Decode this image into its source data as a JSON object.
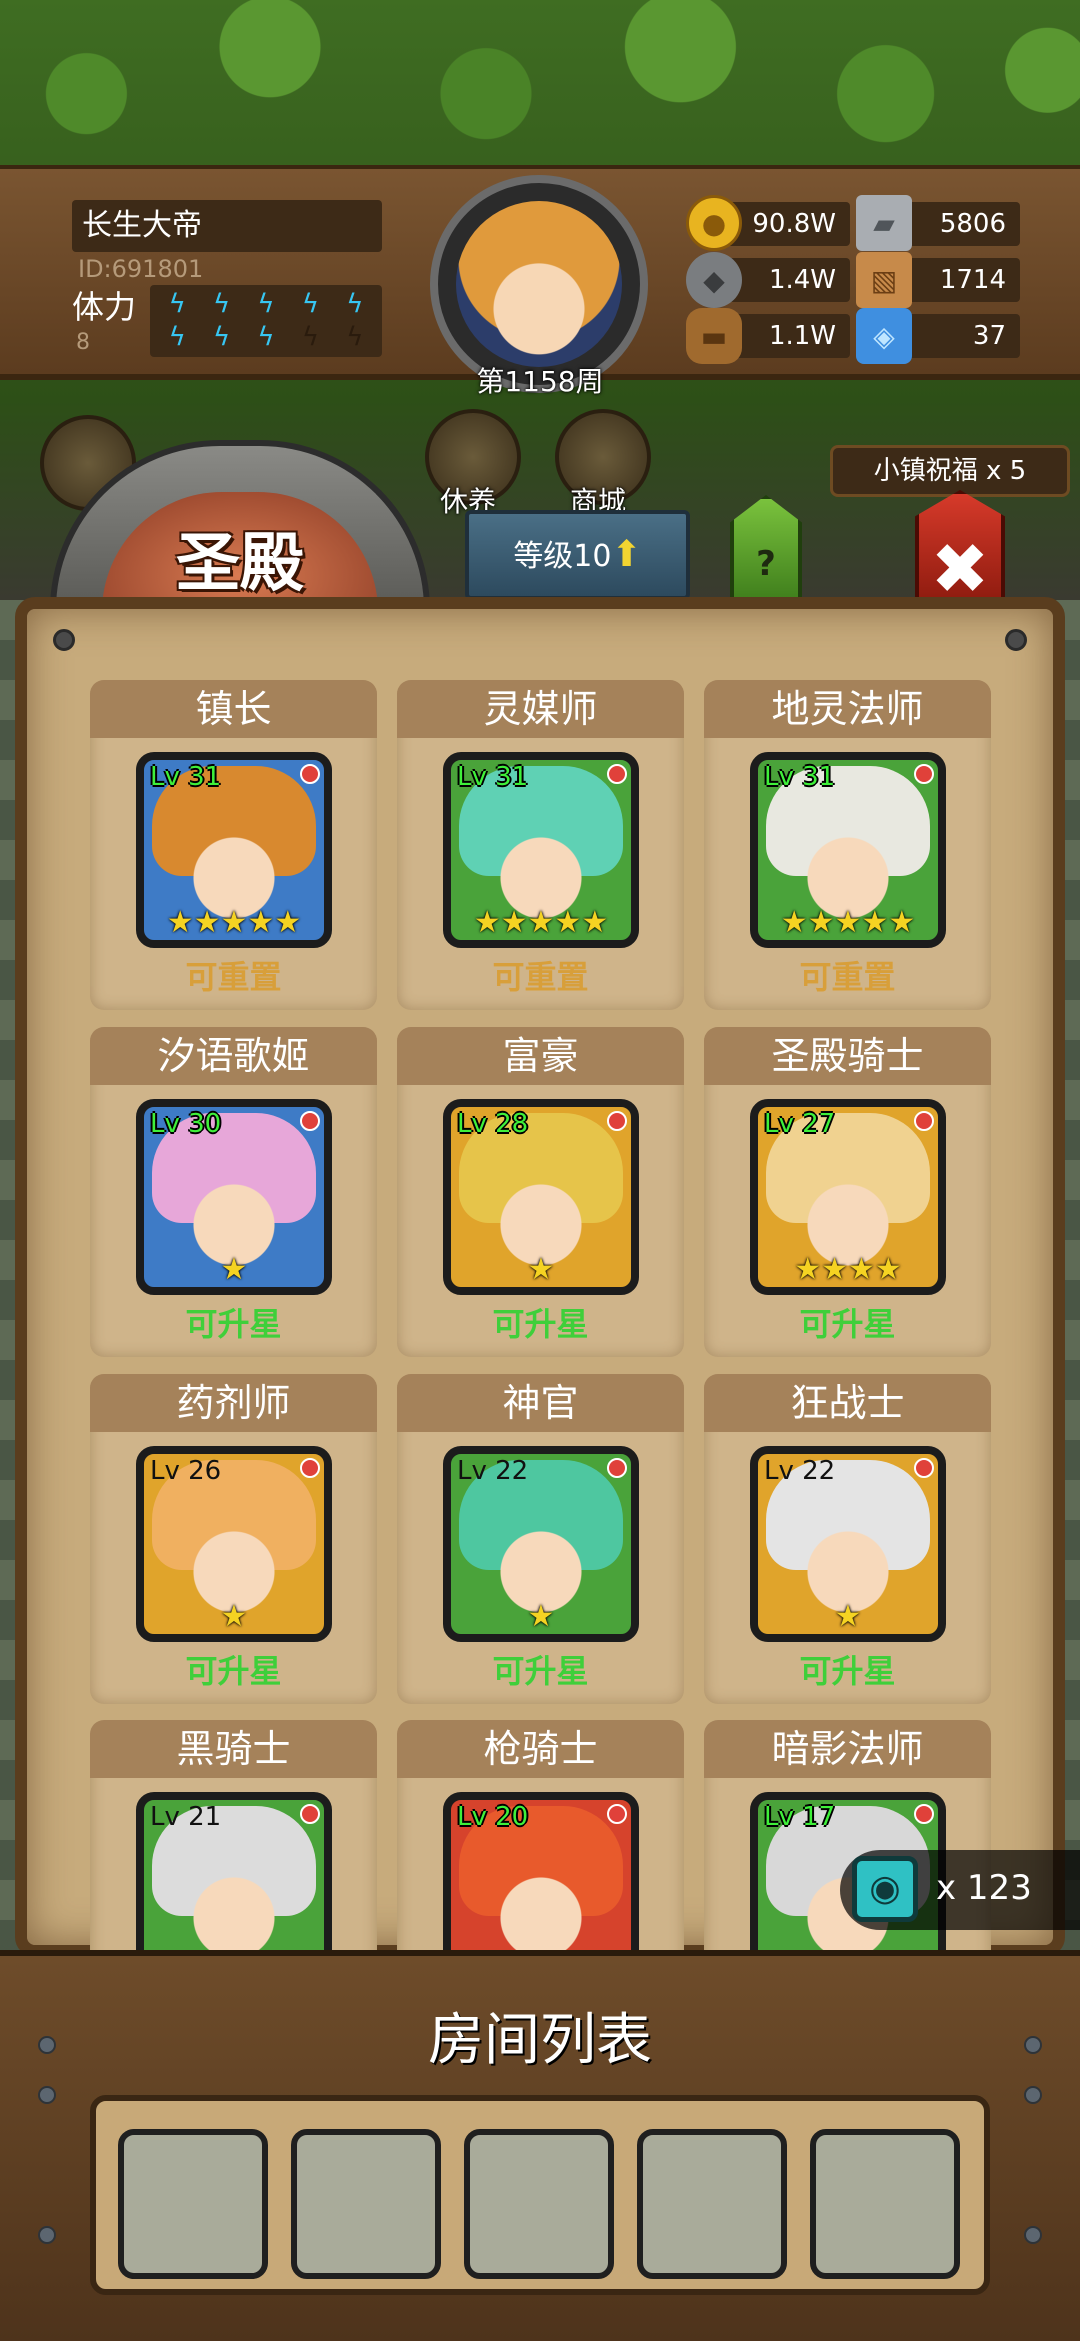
{
  "header": {
    "player_name": "长生大帝",
    "player_id": "ID:691801",
    "stamina_label": "体力",
    "stamina_value": "8",
    "stamina_full_count": 8,
    "week_label": "第1158周",
    "icons": {
      "gold": "gold-coin-icon",
      "iron": "iron-ingot-icon",
      "stone": "stone-icon",
      "leather": "leather-icon",
      "wood": "wood-icon",
      "crystal": "crystal-icon"
    }
  },
  "resources": {
    "gold": "90.8W",
    "iron": "5806",
    "stone": "1.4W",
    "leather": "1714",
    "wood": "1.1W",
    "crystal": "37"
  },
  "menu": {
    "rest_label": "休养",
    "mall_label": "商城",
    "blessing": "小镇祝福 x 5"
  },
  "title": {
    "hall": "圣殿",
    "level": "等级10",
    "help": "?",
    "close": "✖"
  },
  "heroes": [
    {
      "name": "镇长",
      "level": "Lv 31",
      "stars": "★★★★★",
      "status": "可重置",
      "frame": "blue",
      "hair": "#d8892f"
    },
    {
      "name": "灵媒师",
      "level": "Lv 31",
      "stars": "★★★★★",
      "status": "可重置",
      "frame": "green",
      "hair": "#5fd1b4"
    },
    {
      "name": "地灵法师",
      "level": "Lv 31",
      "stars": "★★★★★",
      "status": "可重置",
      "frame": "green",
      "hair": "#e8e8e0"
    },
    {
      "name": "汐语歌姬",
      "level": "Lv 30",
      "stars": "★",
      "status": "可升星",
      "frame": "blue",
      "hair": "#e7a7d9"
    },
    {
      "name": "富豪",
      "level": "Lv 28",
      "stars": "★",
      "status": "可升星",
      "frame": "gold",
      "hair": "#e6c44a"
    },
    {
      "name": "圣殿骑士",
      "level": "Lv 27",
      "stars": "★★★★",
      "status": "可升星",
      "frame": "gold",
      "hair": "#f0d290"
    },
    {
      "name": "药剂师",
      "level": "Lv 26",
      "stars": "★",
      "status": "可升星",
      "frame": "gold",
      "hair": "#f0b060"
    },
    {
      "name": "神官",
      "level": "Lv 22",
      "stars": "★",
      "status": "可升星",
      "frame": "green",
      "hair": "#4ec7a0"
    },
    {
      "name": "狂战士",
      "level": "Lv 22",
      "stars": "★",
      "status": "可升星",
      "frame": "gold",
      "hair": "#e4e4e4"
    },
    {
      "name": "黑骑士",
      "level": "Lv 21",
      "stars": "",
      "status": "",
      "frame": "green",
      "hair": "#dcdcdc"
    },
    {
      "name": "枪骑士",
      "level": "Lv 20",
      "stars": "",
      "status": "",
      "frame": "red",
      "hair": "#e85a2c"
    },
    {
      "name": "暗影法师",
      "level": "Lv 17",
      "stars": "",
      "status": "",
      "frame": "green",
      "hair": "#d8d8d8"
    }
  ],
  "gems": {
    "count": "x 123",
    "icon": "eye-gem-icon"
  },
  "room_list": {
    "title": "房间列表",
    "slot_count": 5
  }
}
